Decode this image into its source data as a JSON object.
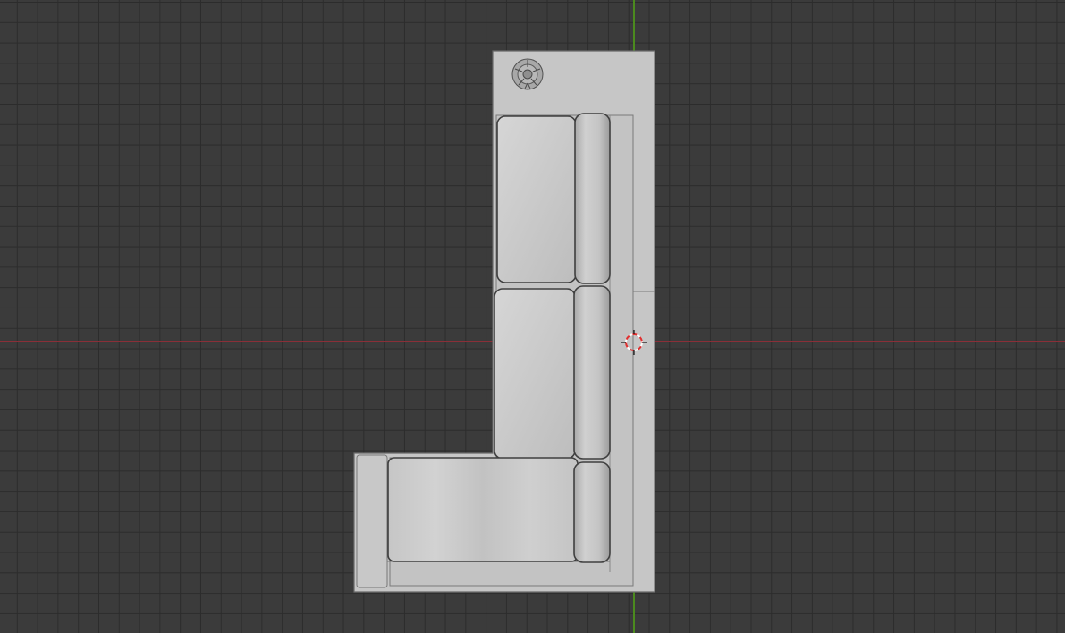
{
  "viewport": {
    "background_color": "#3b3b3b",
    "grid_line_color": "#2c2c2c",
    "x_axis_color": "#8a2f38",
    "y_axis_color": "#4b8a1e"
  },
  "model": {
    "object": "l-shaped-sectional-sofa",
    "view": "top",
    "seat_cushions": 3,
    "back_cushions": 3,
    "mesh_color": "#c8c8c8"
  },
  "cursor": {
    "icon": "3d-cursor-icon",
    "colors": [
      "#e03030",
      "#ffffff"
    ]
  }
}
